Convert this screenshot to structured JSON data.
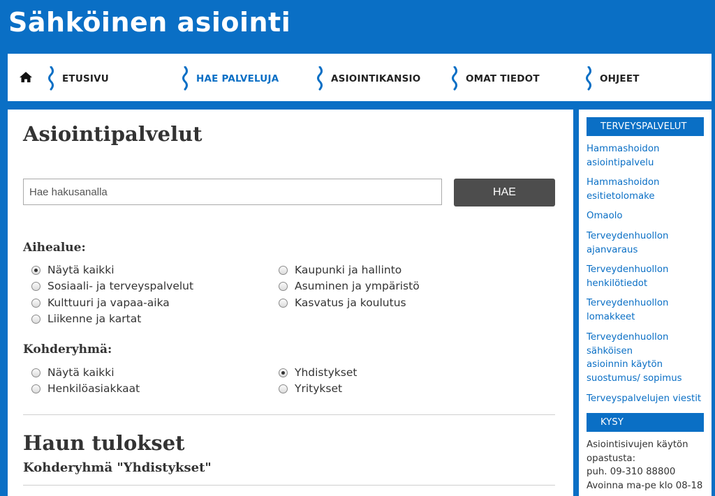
{
  "header": {
    "title": "Sähköinen asiointi"
  },
  "nav": {
    "items": [
      {
        "label": "ETUSIVU"
      },
      {
        "label": "HAE PALVELUJA"
      },
      {
        "label": "ASIOINTIKANSIO"
      },
      {
        "label": "OMAT TIEDOT"
      },
      {
        "label": "OHJEET"
      }
    ],
    "active_index": 1
  },
  "main": {
    "title": "Asiointipalvelut",
    "search": {
      "placeholder": "Hae hakusanalla",
      "value": "",
      "button_label": "HAE"
    },
    "topic": {
      "heading": "Aihealue:",
      "options": [
        {
          "label": "Näytä kaikki",
          "checked": true
        },
        {
          "label": "Sosiaali- ja terveyspalvelut",
          "checked": false
        },
        {
          "label": "Kulttuuri ja vapaa-aika",
          "checked": false
        },
        {
          "label": "Liikenne ja kartat",
          "checked": false
        },
        {
          "label": "Kaupunki ja hallinto",
          "checked": false
        },
        {
          "label": "Asuminen ja ympäristö",
          "checked": false
        },
        {
          "label": "Kasvatus ja koulutus",
          "checked": false
        }
      ]
    },
    "target": {
      "heading": "Kohderyhmä:",
      "options": [
        {
          "label": "Näytä kaikki",
          "checked": false
        },
        {
          "label": "Henkilöasiakkaat",
          "checked": false
        },
        {
          "label": "Yhdistykset",
          "checked": true
        },
        {
          "label": "Yritykset",
          "checked": false
        }
      ]
    },
    "results": {
      "title": "Haun tulokset",
      "subtitle": "Kohderyhmä \"Yhdistykset\""
    }
  },
  "sidebar": {
    "health": {
      "header": "TERVEYSPALVELUT",
      "links": [
        "Hammashoidon\nasiointipalvelu",
        "Hammashoidon\nesitietolomake",
        "Omaolo",
        "Terveydenhuollon\najanvaraus",
        "Terveydenhuollon\nhenkilötiedot",
        "Terveydenhuollon\nlomakkeet",
        "Terveydenhuollon\nsähköisen\nasioinnin käytön\nsuostumus/ sopimus",
        "Terveyspalvelujen viestit"
      ]
    },
    "ask": {
      "header": "KYSY",
      "text": "Asiointisivujen käytön\nopastusta:\npuh. 09-310 88800\nAvoinna ma-pe klo 08-18"
    }
  },
  "colors": {
    "brand": "#0a6fc5",
    "button": "#4d4d4d"
  },
  "icons": {
    "home": "home-icon",
    "nav_separator": "wave-separator-icon"
  }
}
